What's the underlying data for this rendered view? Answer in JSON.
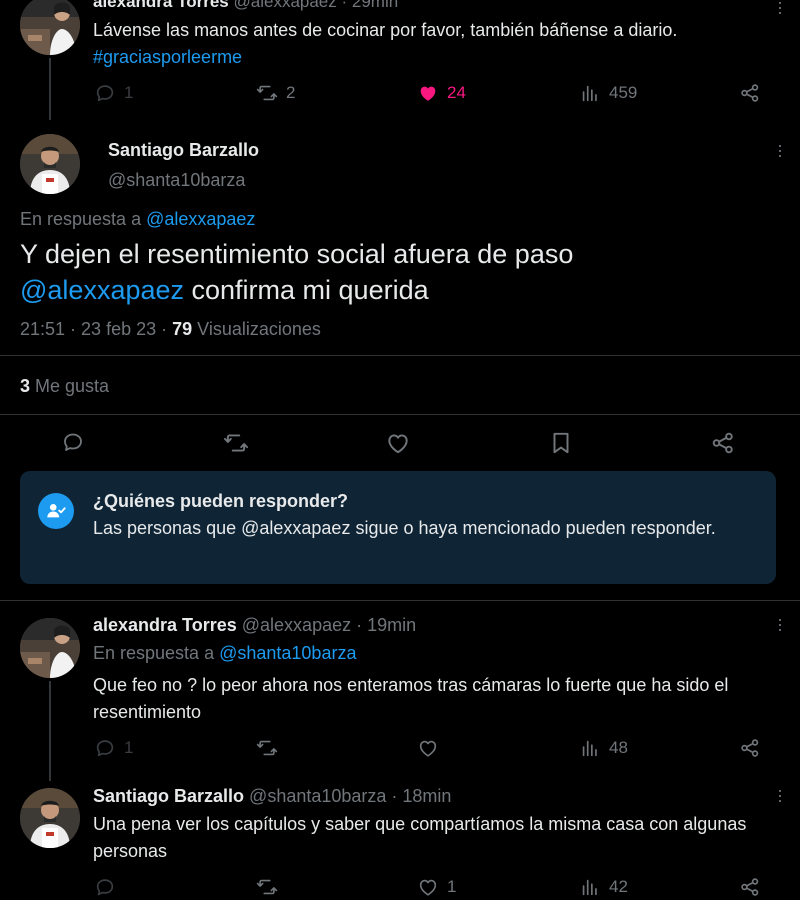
{
  "parent_tweet": {
    "name": "alexandra Torres",
    "handle": "@alexxapaez · 29min",
    "text": "Lávense las manos antes de cocinar por favor, también báñense a diario.",
    "hashtag": "#graciasporleerme",
    "replies": "1",
    "retweets": "2",
    "likes": "24",
    "views": "459",
    "like_color": "#f91880"
  },
  "main_tweet": {
    "name": "Santiago Barzallo",
    "handle": "@shanta10barza",
    "reply_prefix": "En respuesta a",
    "reply_to": "@alexxapaez",
    "text_line1": "Y dejen el resentimiento social afuera de paso",
    "mention": "@alexxapaez",
    "text_rest": " confirma mi querida",
    "time": "21:51 · 23 feb 23 · ",
    "views_count": "79",
    "views_label": " Visualizaciones",
    "likes_count": "3",
    "likes_label": " Me gusta"
  },
  "who_can_reply": {
    "title": "¿Quiénes pueden responder?",
    "body": "Las personas que @alexxapaez sigue o haya mencionado pueden responder."
  },
  "replies": [
    {
      "name": "alexandra Torres",
      "handle": "@alexxapaez · 19min",
      "reply_prefix": "En respuesta a",
      "reply_to": "@shanta10barza",
      "text": "Que feo no ? lo peor ahora  nos enteramos tras cámaras lo fuerte que ha sido el resentimiento",
      "replies": "1",
      "retweets": "",
      "likes": "",
      "views": "48"
    },
    {
      "name": "Santiago Barzallo",
      "handle": "@shanta10barza · 18min",
      "text": "Una pena ver los capítulos y saber que compartíamos la misma casa con algunas personas",
      "replies": "",
      "retweets": "",
      "likes": "1",
      "views": "42"
    }
  ],
  "colors": {
    "accent": "#1d9bf0",
    "muted": "#71767b",
    "card_bg": "#0f2536"
  },
  "icons": [
    "reply-icon",
    "retweet-icon",
    "like-icon",
    "views-icon",
    "share-icon",
    "bookmark-icon",
    "more-icon",
    "people-check-icon"
  ]
}
